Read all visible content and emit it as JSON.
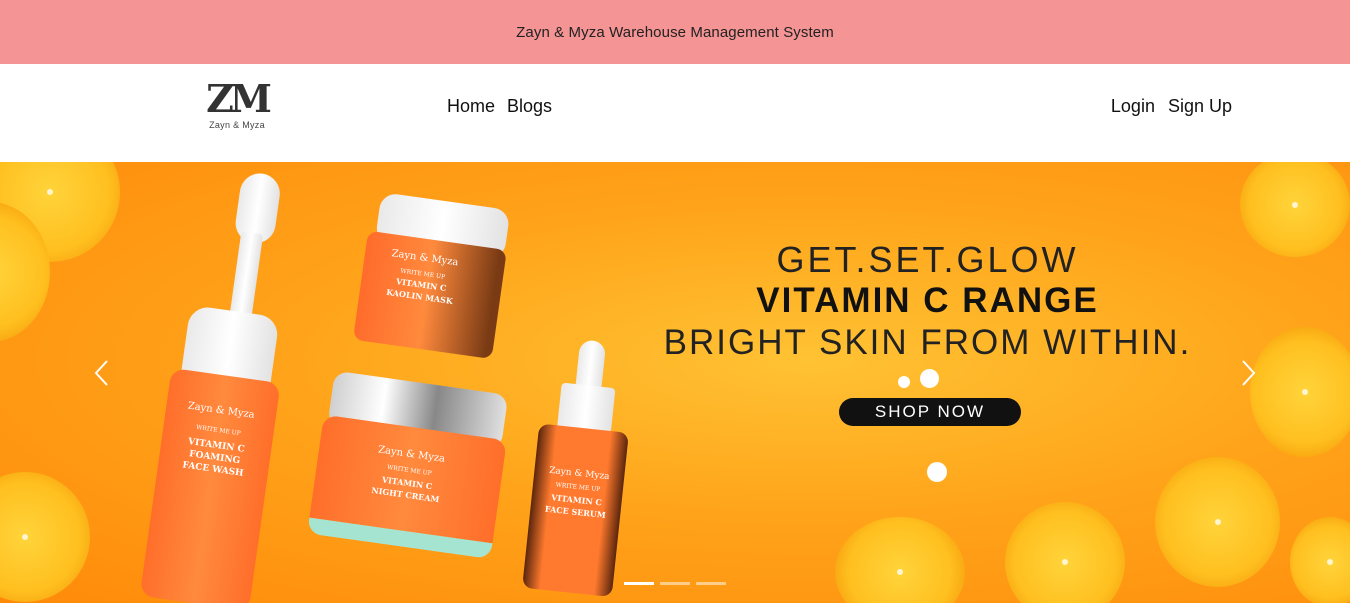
{
  "topbar": {
    "title": "Zayn & Myza Warehouse Management System"
  },
  "brand": {
    "mark": "ZM",
    "name": "Zayn & Myza"
  },
  "nav": {
    "left": [
      "Home",
      "Blogs"
    ],
    "right": [
      "Login",
      "Sign Up"
    ]
  },
  "hero": {
    "line1": "GET.SET.GLOW",
    "line2": "VITAMIN C RANGE",
    "line3": "BRIGHT SKIN FROM WITHIN.",
    "cta": "SHOP NOW",
    "products": {
      "face_wash": {
        "brand": "Zayn & Myza",
        "sub": "WRITE ME UP",
        "name": "VITAMIN C FOAMING FACE WASH"
      },
      "kaolin": {
        "brand": "Zayn & Myza",
        "sub": "WRITE ME UP",
        "name": "VITAMIN C KAOLIN MASK"
      },
      "night_cream": {
        "brand": "Zayn & Myza",
        "sub": "WRITE ME UP",
        "name": "VITAMIN C NIGHT CREAM"
      },
      "serum": {
        "brand": "Zayn & Myza",
        "sub": "WRITE ME UP",
        "name": "VITAMIN C FACE SERUM"
      }
    },
    "prev_icon": "chevron-left-icon",
    "next_icon": "chevron-right-icon",
    "slides_count": 3,
    "active_slide": 1
  },
  "colors": {
    "topbar": "#f49494",
    "hero_bg": "#ffa41a",
    "cta_bg": "#111111"
  }
}
